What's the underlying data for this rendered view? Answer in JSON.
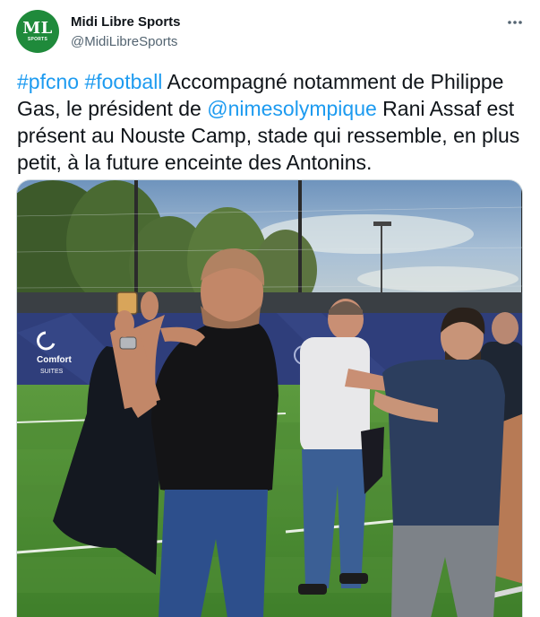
{
  "account": {
    "name": "Midi Libre Sports",
    "handle": "@MidiLibreSports",
    "avatar_initials": "ML",
    "avatar_sub": "SPORTS",
    "avatar_color": "#1f8a3b"
  },
  "tweet": {
    "hashtag_1": "#pfcno",
    "hashtag_2": "#football",
    "text_1": " Accompagné notamment de Philippe Gas, le président de ",
    "mention": "@nimesolympique",
    "text_2": " Rani Assaf est présent au Nouste Camp, stade qui ressemble, en plus petit, à la future enceinte des Antonins."
  },
  "photo": {
    "banner_brand": "Comfort",
    "banner_sub": "SUITES"
  },
  "colors": {
    "link": "#1d9bf0",
    "text": "#0f1419",
    "muted": "#536471"
  },
  "icons": {
    "more": "more-horizontal-icon"
  }
}
